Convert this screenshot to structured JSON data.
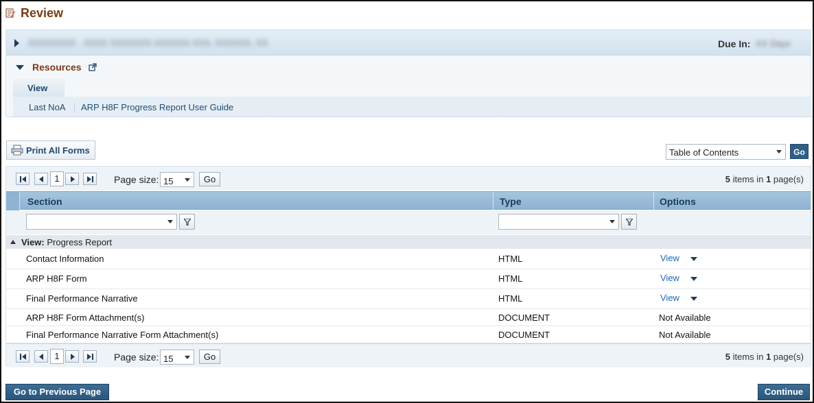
{
  "page": {
    "title": "Review"
  },
  "org": {
    "name": "XXXXXXXX · XXXX XXXXXXX XXXXXX XXX, XXXXXX, XX",
    "due_label": "Due In:",
    "due_value": "XX Days"
  },
  "resources": {
    "label": "Resources",
    "tab": "View",
    "links": [
      "Last NoA",
      "ARP H8F Progress Report User Guide"
    ]
  },
  "toolbar": {
    "print_label": "Print All Forms",
    "toc_selected": "Table of Contents",
    "go_label": "Go"
  },
  "pager": {
    "current_page": "1",
    "page_size_label": "Page size:",
    "page_size": "15",
    "go_label": "Go",
    "items_count": "5",
    "items_text": "items in",
    "pages_count": "1",
    "pages_text": "page(s)"
  },
  "grid": {
    "columns": [
      "Section",
      "Type",
      "Options"
    ],
    "group": {
      "label": "View:",
      "value": "Progress Report"
    },
    "rows": [
      {
        "section": "Contact Information",
        "type": "HTML",
        "option": "View"
      },
      {
        "section": "ARP H8F Form",
        "type": "HTML",
        "option": "View"
      },
      {
        "section": "Final Performance Narrative",
        "type": "HTML",
        "option": "View"
      },
      {
        "section": "ARP H8F Form Attachment(s)",
        "type": "DOCUMENT",
        "option": "Not Available"
      },
      {
        "section": "Final Performance Narrative Form Attachment(s)",
        "type": "DOCUMENT",
        "option": "Not Available"
      }
    ]
  },
  "footer": {
    "prev_label": "Go to Previous Page",
    "continue_label": "Continue"
  }
}
